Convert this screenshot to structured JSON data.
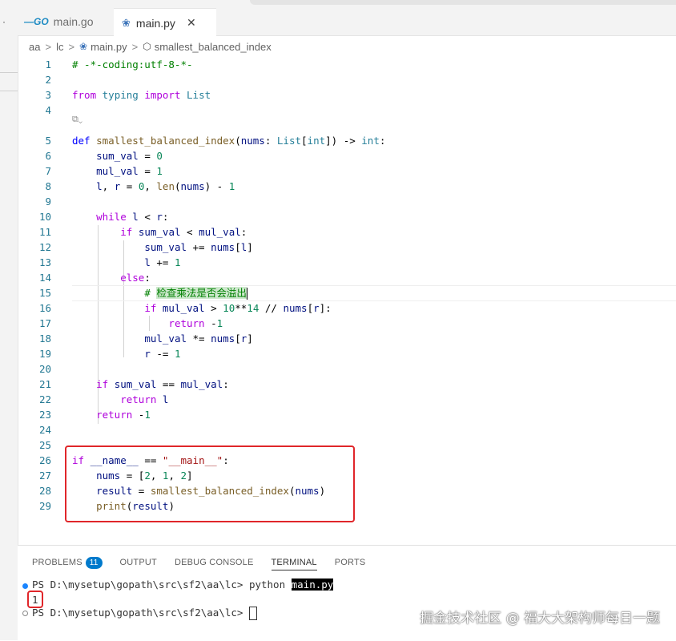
{
  "tabs": [
    {
      "label": "main.go",
      "icon": "go-file-icon",
      "icon_text": "—GO"
    },
    {
      "label": "main.py",
      "icon": "python-file-icon",
      "active": true
    }
  ],
  "breadcrumb": {
    "items": [
      "aa",
      "lc",
      "main.py",
      "smallest_balanced_index"
    ]
  },
  "code_lines": [
    {
      "n": "1",
      "html": "<span class='cm'># -*-coding:utf-8-*-</span>"
    },
    {
      "n": "2",
      "html": ""
    },
    {
      "n": "3",
      "html": "<span class='ctl'>from</span> <span class='ty'>typing</span> <span class='ctl'>import</span> <span class='ty'>List</span>"
    },
    {
      "n": "4",
      "html": ""
    },
    {
      "n": "5",
      "html": "<span class='kw'>def</span> <span class='fn'>smallest_balanced_index</span>(<span class='var'>nums</span>: <span class='ty'>List</span>[<span class='ty'>int</span>]) -&gt; <span class='ty'>int</span>:"
    },
    {
      "n": "6",
      "html": "    <span class='var'>sum_val</span> = <span class='num'>0</span>"
    },
    {
      "n": "7",
      "html": "    <span class='var'>mul_val</span> = <span class='num'>1</span>"
    },
    {
      "n": "8",
      "html": "    <span class='var'>l</span>, <span class='var'>r</span> = <span class='num'>0</span>, <span class='fn'>len</span>(<span class='var'>nums</span>) - <span class='num'>1</span>"
    },
    {
      "n": "9",
      "html": ""
    },
    {
      "n": "10",
      "html": "    <span class='ctl'>while</span> <span class='var'>l</span> &lt; <span class='var'>r</span>:"
    },
    {
      "n": "11",
      "html": "        <span class='ctl'>if</span> <span class='var'>sum_val</span> &lt; <span class='var'>mul_val</span>:"
    },
    {
      "n": "12",
      "html": "            <span class='var'>sum_val</span> += <span class='var'>nums</span>[<span class='var'>l</span>]"
    },
    {
      "n": "13",
      "html": "            <span class='var'>l</span> += <span class='num'>1</span>"
    },
    {
      "n": "14",
      "html": "        <span class='ctl'>else</span>:"
    },
    {
      "n": "15",
      "html": "            <span class='cm'># <span class='sel'>检查乘法是否会溢出</span></span><span class='caret'></span>"
    },
    {
      "n": "16",
      "html": "            <span class='ctl'>if</span> <span class='var'>mul_val</span> &gt; <span class='num'>10</span>**<span class='num'>14</span> // <span class='var'>nums</span>[<span class='var'>r</span>]:"
    },
    {
      "n": "17",
      "html": "                <span class='ctl'>return</span> -<span class='num'>1</span>"
    },
    {
      "n": "18",
      "html": "            <span class='var'>mul_val</span> *= <span class='var'>nums</span>[<span class='var'>r</span>]"
    },
    {
      "n": "19",
      "html": "            <span class='var'>r</span> -= <span class='num'>1</span>"
    },
    {
      "n": "20",
      "html": ""
    },
    {
      "n": "21",
      "html": "    <span class='ctl'>if</span> <span class='var'>sum_val</span> == <span class='var'>mul_val</span>:"
    },
    {
      "n": "22",
      "html": "        <span class='ctl'>return</span> <span class='var'>l</span>"
    },
    {
      "n": "23",
      "html": "    <span class='ctl'>return</span> -<span class='num'>1</span>"
    },
    {
      "n": "24",
      "html": ""
    },
    {
      "n": "25",
      "html": ""
    },
    {
      "n": "26",
      "html": "<span class='ctl'>if</span> <span class='var'>__name__</span> == <span class='str'>\"__main__\"</span>:"
    },
    {
      "n": "27",
      "html": "    <span class='var'>nums</span> = [<span class='num'>2</span>, <span class='num'>1</span>, <span class='num'>2</span>]"
    },
    {
      "n": "28",
      "html": "    <span class='var'>result</span> = <span class='fn'>smallest_balanced_index</span>(<span class='var'>nums</span>)"
    },
    {
      "n": "29",
      "html": "    <span class='fn'>print</span>(<span class='var'>result</span>)"
    }
  ],
  "panel": {
    "tabs": [
      "PROBLEMS",
      "OUTPUT",
      "DEBUG CONSOLE",
      "TERMINAL",
      "PORTS"
    ],
    "problems_count": "11",
    "active_tab": "TERMINAL"
  },
  "terminal": {
    "prompt": "PS D:\\mysetup\\gopath\\src\\sf2\\aa\\lc> ",
    "command": "python ",
    "command_arg": "main.py",
    "output": "1",
    "prompt2": "PS D:\\mysetup\\gopath\\src\\sf2\\aa\\lc> "
  },
  "watermark": "掘金技术社区 @ 福大大架构师每日一题",
  "colors": {
    "highlight_box": "#e0262a",
    "accent": "#007acc"
  }
}
